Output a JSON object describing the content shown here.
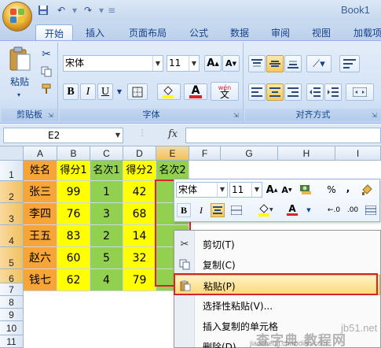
{
  "title_bar": {
    "book_title": "Book1"
  },
  "qat": {
    "save_icon": "save-icon",
    "undo_icon": "undo-icon",
    "redo_icon": "redo-icon"
  },
  "tabs": [
    "开始",
    "插入",
    "页面布局",
    "公式",
    "数据",
    "审阅",
    "视图",
    "加载项"
  ],
  "ribbon": {
    "clipboard": {
      "paste_label": "粘贴",
      "group_label": "剪贴板"
    },
    "font": {
      "font_name": "宋体",
      "font_size": "11",
      "bold": "B",
      "italic": "I",
      "underline": "U",
      "wen": "wén",
      "group_label": "字体"
    },
    "alignment": {
      "group_label": "对齐方式"
    }
  },
  "formula_bar": {
    "name_box": "E2",
    "fx": "fx",
    "content": ""
  },
  "columns": [
    "A",
    "B",
    "C",
    "D",
    "E",
    "F",
    "G",
    "H",
    "I"
  ],
  "rows": [
    "1",
    "2",
    "3",
    "4",
    "5",
    "6",
    "7",
    "8",
    "9",
    "10",
    "11"
  ],
  "sheet": {
    "header": [
      "姓名",
      "得分1",
      "名次1",
      "得分2",
      "名次2"
    ],
    "data": [
      [
        "张三",
        "99",
        "1",
        "42"
      ],
      [
        "李四",
        "76",
        "3",
        "68"
      ],
      [
        "王五",
        "83",
        "2",
        "14"
      ],
      [
        "赵六",
        "60",
        "5",
        "32"
      ],
      [
        "钱七",
        "62",
        "4",
        "79"
      ]
    ]
  },
  "mini_toolbar": {
    "font_name": "宋体",
    "font_size": "11",
    "bold": "B",
    "italic": "I",
    "percent": "%",
    "comma": ","
  },
  "context_menu": {
    "items": [
      "剪切(T)",
      "复制(C)",
      "粘贴(P)",
      "选择性粘贴(V)...",
      "插入复制的单元格",
      "删除(D)..."
    ]
  },
  "watermark": {
    "site": "jb51.net",
    "brand": "查字典 教程网",
    "url": "jiaocheng.chazidian.com"
  },
  "colors": {
    "orange": "#f7a536",
    "yellow": "#ffff00",
    "green": "#92d050",
    "highlight": "#fbd77a",
    "red_frame": "#d8232a"
  }
}
